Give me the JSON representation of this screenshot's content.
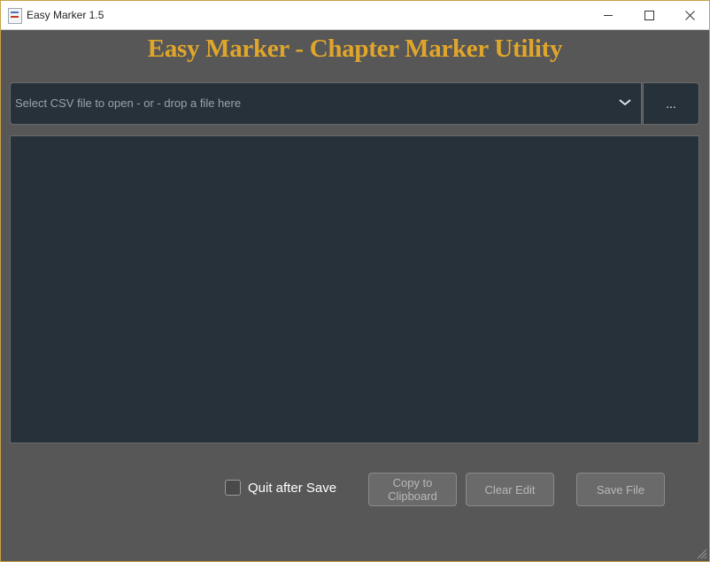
{
  "window": {
    "title": "Easy Marker 1.5"
  },
  "heading": "Easy Marker - Chapter Marker Utility",
  "file_select": {
    "placeholder": "Select CSV file to open - or - drop a file here",
    "browse_label": "..."
  },
  "editor": {
    "value": ""
  },
  "options": {
    "quit_after_save_label": "Quit after Save",
    "quit_after_save_checked": false
  },
  "buttons": {
    "copy_line1": "Copy to",
    "copy_line2": "Clipboard",
    "clear_label": "Clear Edit",
    "save_label": "Save File"
  },
  "colors": {
    "accent": "#e0a62b",
    "panel": "#27313a",
    "background": "#575757",
    "border": "#c8a24a"
  }
}
